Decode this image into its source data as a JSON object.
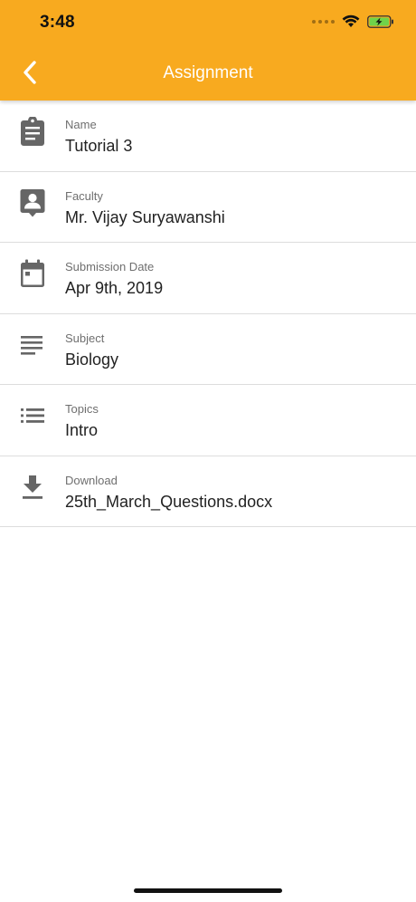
{
  "status_bar": {
    "time": "3:48"
  },
  "header": {
    "title": "Assignment",
    "background_color": "#F8AA1F",
    "back_icon": "chevron-left-icon"
  },
  "fields": [
    {
      "icon": "clipboard-icon",
      "label": "Name",
      "value": "Tutorial 3"
    },
    {
      "icon": "contact-badge-icon",
      "label": "Faculty",
      "value": "Mr. Vijay Suryawanshi"
    },
    {
      "icon": "calendar-icon",
      "label": "Submission Date",
      "value": "Apr 9th, 2019"
    },
    {
      "icon": "lines-icon",
      "label": "Subject",
      "value": "Biology"
    },
    {
      "icon": "list-icon",
      "label": "Topics",
      "value": "Intro"
    },
    {
      "icon": "download-icon",
      "label": "Download",
      "value": "25th_March_Questions.docx"
    }
  ]
}
